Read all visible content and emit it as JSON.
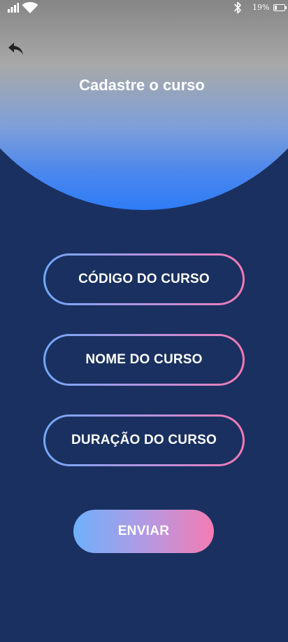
{
  "status_bar": {
    "battery_percent": "19%",
    "icons": [
      "signal-icon",
      "wifi-icon",
      "bluetooth-icon",
      "battery-icon"
    ]
  },
  "header": {
    "back_icon": "back-arrow-icon",
    "title": "Cadastre o curso"
  },
  "form": {
    "course_code_placeholder": "CÓDIGO DO CURSO",
    "course_name_placeholder": "NOME DO CURSO",
    "course_duration_placeholder": "DURAÇÃO DO CURSO",
    "submit_label": "ENVIAR"
  },
  "colors": {
    "background": "#1a3060",
    "accent_blue": "#2f7cf6",
    "gradient_start": "#72a8f8",
    "gradient_end": "#f27ab6",
    "text": "#ffffff"
  }
}
